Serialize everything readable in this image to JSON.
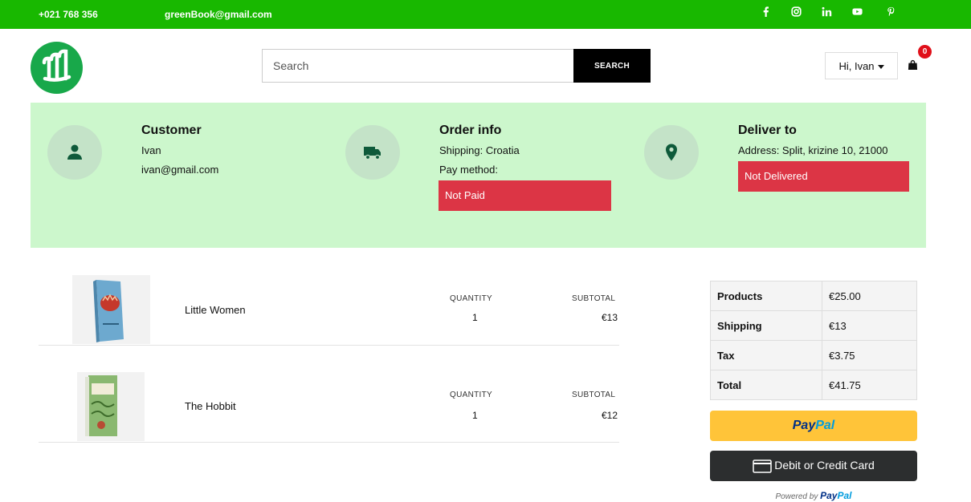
{
  "topbar": {
    "phone": "+021 768 356",
    "email": "greenBook@gmail.com",
    "social": [
      "facebook-icon",
      "instagram-icon",
      "linkedin-icon",
      "youtube-icon",
      "pinterest-icon"
    ]
  },
  "header": {
    "search_placeholder": "Search",
    "search_button": "SEARCH",
    "user_menu": "Hi, Ivan",
    "cart_count": "0"
  },
  "customer": {
    "title": "Customer",
    "name": "Ivan",
    "email": "ivan@gmail.com"
  },
  "order": {
    "title": "Order info",
    "shipping": "Shipping: Croatia",
    "pay_method": "Pay method:",
    "pay_status": "Not Paid"
  },
  "delivery": {
    "title": "Deliver to",
    "address": "Address: Split, krizine 10, 21000",
    "status": "Not Delivered"
  },
  "items": [
    {
      "name": "Little Women",
      "quantity_label": "QUANTITY",
      "quantity": "1",
      "subtotal_label": "SUBTOTAL",
      "subtotal": "€13"
    },
    {
      "name": "The Hobbit",
      "quantity_label": "QUANTITY",
      "quantity": "1",
      "subtotal_label": "SUBTOTAL",
      "subtotal": "€12"
    }
  ],
  "summary": [
    {
      "label": "Products",
      "value": "€25.00"
    },
    {
      "label": "Shipping",
      "value": "€13"
    },
    {
      "label": "Tax",
      "value": "€3.75"
    },
    {
      "label": "Total",
      "value": "€41.75"
    }
  ],
  "payment": {
    "paypal_part1": "Pay",
    "paypal_part2": "Pal",
    "card_label": "Debit or Credit Card",
    "powered_by": "Powered by"
  },
  "colors": {
    "topbar": "#18b800",
    "info_panel": "#ccf7cc",
    "status_red": "#dc3545",
    "paypal_yellow": "#ffc439",
    "logo_green": "#18a84a"
  }
}
